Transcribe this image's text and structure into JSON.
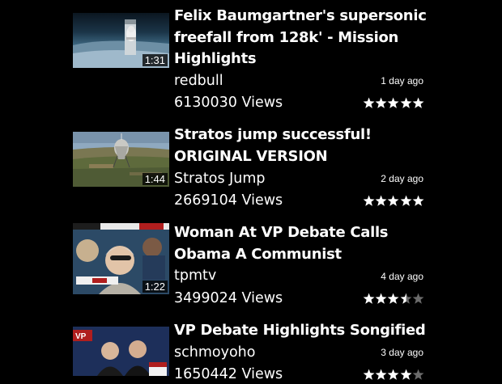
{
  "videos": [
    {
      "title": "Felix Baumgartner's supersonic freefall from 128k' - Mission Highlights",
      "channel": "redbull",
      "views": "6130030 Views",
      "age": "1 day ago",
      "duration": "1:31",
      "rating": 5,
      "thumbnail": "skydiver-in-space-thumbnail"
    },
    {
      "title": "Stratos jump successful! ORIGINAL VERSION",
      "channel": "Stratos Jump",
      "views": "2669104 Views",
      "age": "2 day ago",
      "duration": "1:44",
      "rating": 5,
      "thumbnail": "capsule-over-desert-thumbnail"
    },
    {
      "title": "Woman At VP Debate Calls Obama A Communist",
      "channel": "tpmtv",
      "views": "3499024 Views",
      "age": "4 day ago",
      "duration": "1:22",
      "rating": 3.5,
      "thumbnail": "news-crowd-thumbnail"
    },
    {
      "title": "VP Debate Highlights Songified",
      "channel": "schmoyoho",
      "views": "1650442 Views",
      "age": "3 day ago",
      "duration": "",
      "rating": 4,
      "thumbnail": "vp-debate-songify-thumbnail"
    }
  ],
  "colors": {
    "background": "#000000",
    "text": "#ffffff",
    "star_filled": "#ffffff",
    "star_empty": "#6b6b6b"
  }
}
